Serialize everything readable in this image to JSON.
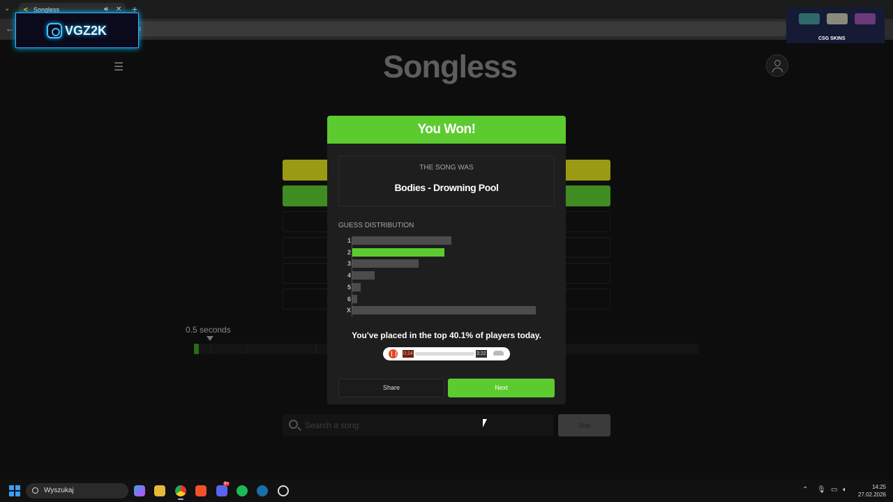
{
  "browser": {
    "tab_title": "Songless",
    "url_fragment": "s"
  },
  "overlays": {
    "streamer_name": "VGZ2K",
    "sponsor_caption": "CSG SKINS"
  },
  "app": {
    "title": "Songless",
    "duration_label": "0.5 seconds",
    "search_placeholder": "Search a song",
    "skip_label": "Skip",
    "colors": {
      "accent_green": "#5ccb2f",
      "skip_yellow": "#9a9a14",
      "correct_green": "#3f8c22"
    }
  },
  "modal": {
    "heading": "You Won!",
    "song_label": "THE SONG WAS",
    "song_name": "Bodies - Drowning Pool",
    "distribution_label": "GUESS DISTRIBUTION",
    "distribution": [
      {
        "label": "1",
        "value": 0.54
      },
      {
        "label": "2",
        "value": 0.5,
        "highlight": true
      },
      {
        "label": "3",
        "value": 0.36
      },
      {
        "label": "4",
        "value": 0.12
      },
      {
        "label": "5",
        "value": 0.045
      },
      {
        "label": "6",
        "value": 0.025
      },
      {
        "label": "X",
        "value": 1.0
      }
    ],
    "placed_text": "You've placed in the top 40.1% of players today.",
    "player": {
      "elapsed": "0:24",
      "total": "3:22"
    },
    "share_label": "Share",
    "next_label": "Next"
  },
  "taskbar": {
    "search_label": "Wyszukaj",
    "time": "14:25",
    "date": "27.02.2026",
    "discord_badge": "9+"
  }
}
